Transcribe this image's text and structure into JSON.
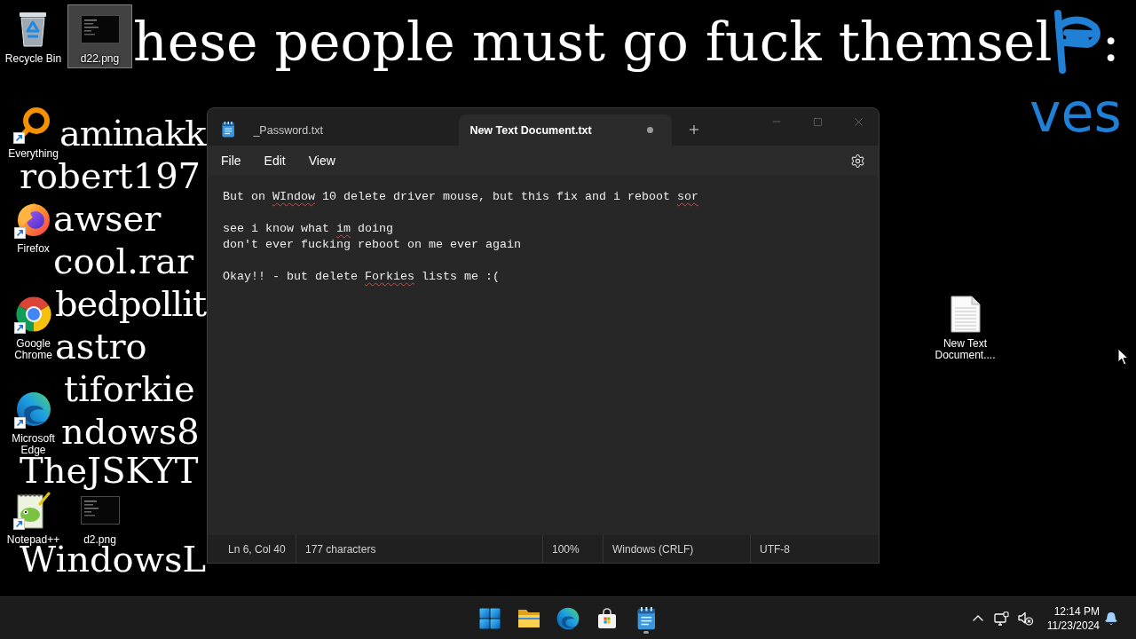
{
  "wallpaper": {
    "headline": {
      "text": "hese people must go fuck themsel",
      "end": ":"
    },
    "lines": [
      "aminakk",
      "robert197",
      "awser",
      "cool.rar",
      "bedpollit",
      "astro",
      "tiforkie",
      "ndows8",
      "TheJSKYT",
      "WindowsL"
    ],
    "annotation": "ves"
  },
  "desktop_icons": [
    {
      "label": "Recycle Bin",
      "kind": "recycle",
      "selected": false,
      "shortcut": false
    },
    {
      "label": "d22.png",
      "kind": "image",
      "selected": true,
      "shortcut": false
    },
    {
      "label": "Everything",
      "kind": "magnifier",
      "selected": false,
      "shortcut": true
    },
    {
      "label": "Firefox",
      "kind": "firefox",
      "selected": false,
      "shortcut": true
    },
    {
      "label": "Google Chrome",
      "kind": "chrome",
      "selected": false,
      "shortcut": true
    },
    {
      "label": "New Text Document....",
      "kind": "textfile",
      "selected": false,
      "shortcut": false
    },
    {
      "label": "Microsoft Edge",
      "kind": "edge",
      "selected": false,
      "shortcut": true
    },
    {
      "label": "Notepad++",
      "kind": "notepadpp",
      "selected": false,
      "shortcut": true
    },
    {
      "label": "d2.png",
      "kind": "image",
      "selected": false,
      "shortcut": false
    }
  ],
  "notepad": {
    "tabs": [
      {
        "title": "_Password.txt",
        "selected": false,
        "modified": false
      },
      {
        "title": "New Text Document.txt",
        "selected": true,
        "modified": true
      }
    ],
    "menu": [
      "File",
      "Edit",
      "View"
    ],
    "paragraphs": [
      {
        "lines": [
          {
            "segments": [
              {
                "text": "But on ",
                "misspelled": false
              },
              {
                "text": "WIndow",
                "misspelled": true
              },
              {
                "text": " 10 delete driver mouse, but this fix and i reboot ",
                "misspelled": false
              },
              {
                "text": "sor",
                "misspelled": true
              }
            ]
          }
        ]
      },
      {
        "lines": [
          {
            "segments": [
              {
                "text": "see i know what ",
                "misspelled": false
              },
              {
                "text": "im",
                "misspelled": true
              },
              {
                "text": " doing",
                "misspelled": false
              }
            ]
          },
          {
            "segments": [
              {
                "text": "don't ever fucking reboot on me ever again",
                "misspelled": false
              }
            ]
          }
        ]
      },
      {
        "lines": [
          {
            "segments": [
              {
                "text": "Okay!! - but delete ",
                "misspelled": false
              },
              {
                "text": "Forkies",
                "misspelled": true
              },
              {
                "text": " lists me :(",
                "misspelled": false
              }
            ]
          }
        ]
      }
    ],
    "status_bar": [
      "Ln 6, Col 40",
      "177 characters",
      "100%",
      "Windows (CRLF)",
      "UTF-8"
    ]
  },
  "taskbar": {
    "apps": [
      {
        "kind": "start",
        "running": false
      },
      {
        "kind": "explorer",
        "running": false
      },
      {
        "kind": "edge",
        "running": false
      },
      {
        "kind": "store",
        "running": false
      },
      {
        "kind": "notepad",
        "running": true
      }
    ],
    "clock": {
      "time": "12:14 PM",
      "date": "11/23/2024"
    }
  }
}
